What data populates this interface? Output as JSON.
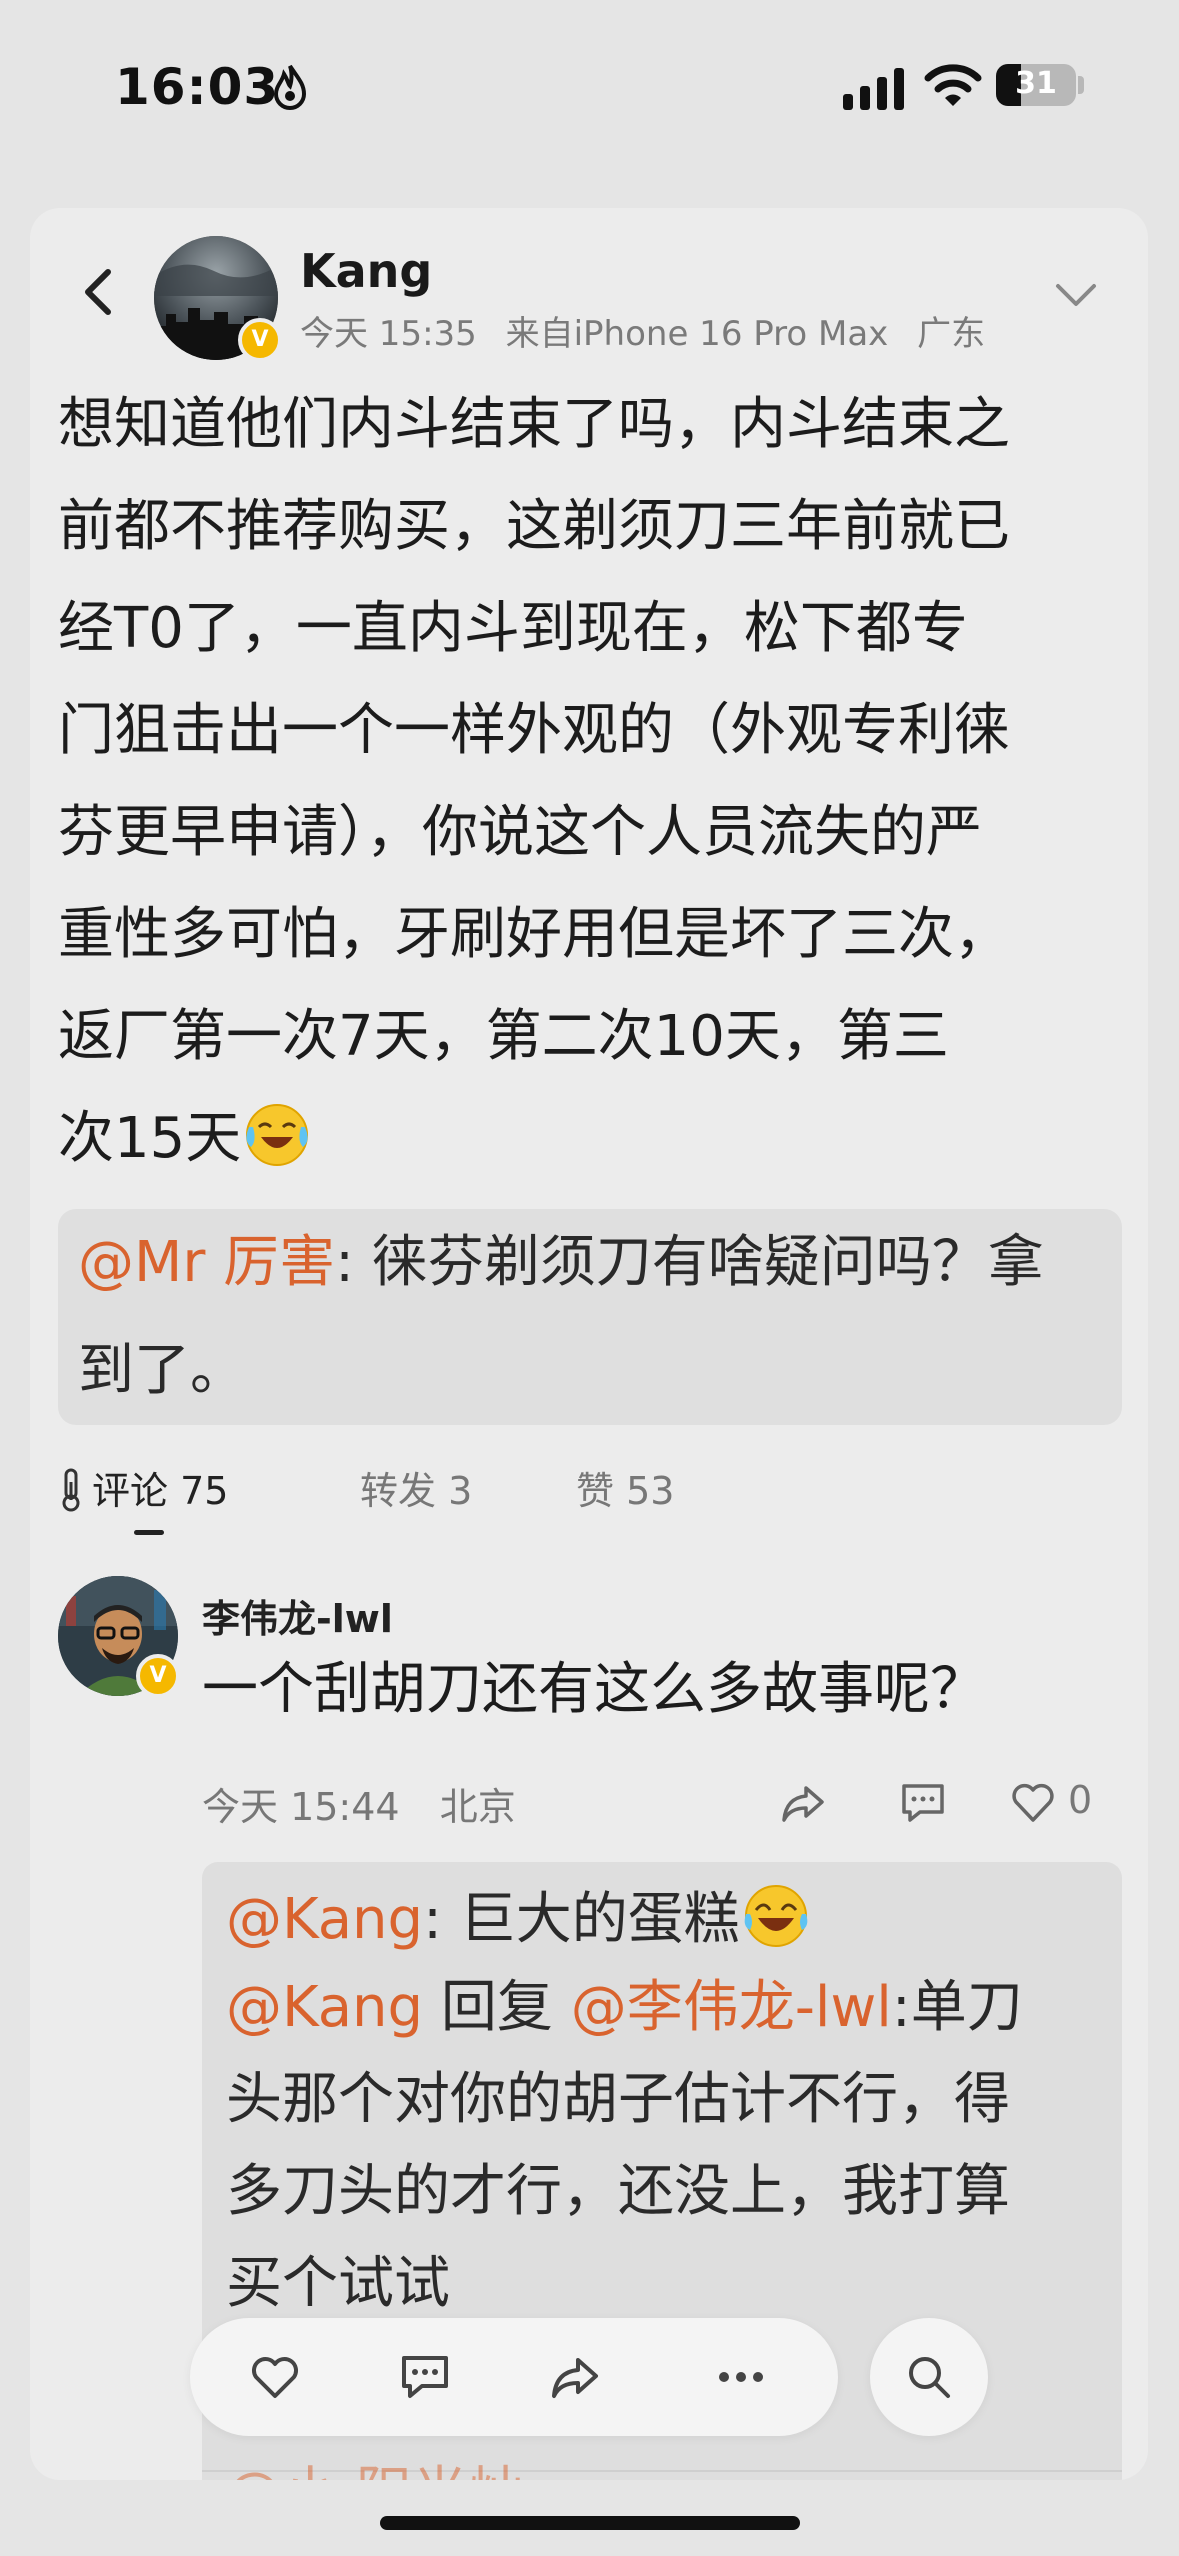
{
  "status": {
    "time": "16:03",
    "battery": "31",
    "battery_level": 0.31
  },
  "post": {
    "author": "Kang",
    "date": "今天 15:35",
    "source": "来自iPhone 16 Pro Max",
    "location": "广东",
    "verified": "V",
    "lines": [
      "想知道他们内斗结束了吗，内斗结束之",
      "前都不推荐购买，这剃须刀三年前就已",
      "经T0了，一直内斗到现在，松下都专",
      "门狙击出一个一样外观的（外观专利徕",
      "芬更早申请），你说这个人员流失的严",
      "重性多可怕，牙刷好用但是坏了三次，",
      "返厂第一次7天，第二次10天，第三",
      "次15天"
    ],
    "quote": {
      "mention": "@Mr 厉害",
      "line1": ": 徕芬剃须刀有啥疑问吗？拿",
      "line2": "到了。"
    }
  },
  "tabs": {
    "comments": "评论 75",
    "reposts": "转发 3",
    "likes": "赞 53"
  },
  "comment": {
    "name": "李伟龙-lwl",
    "text": "一个刮胡刀还有这么多故事呢？",
    "date": "今天 15:44",
    "location": "北京",
    "likes": "0",
    "verified": "V",
    "replies": {
      "r1_mention": "@Kang",
      "r1_text": ": 巨大的蛋糕",
      "r2_mention": "@Kang",
      "r2_reply_word": " 回复 ",
      "r2_target": "@李伟龙-lwl",
      "r2_line1": ":单刀",
      "r2_line2": "头那个对你的胡子估计不行，得",
      "r2_line3": "多刀头的才行，还没上，我打算",
      "r2_line4": "买个试试",
      "r3_partial": "@小 阳光灿"
    }
  },
  "icons": [
    "back-icon",
    "chevron-down-icon",
    "thermometer-icon",
    "share-icon",
    "comment-icon",
    "heart-icon",
    "more-icon",
    "search-icon",
    "laugh-cry-emoji",
    "laugh-emoji"
  ],
  "colors": {
    "mention": "#d9632e",
    "badge": "#f5b800"
  }
}
